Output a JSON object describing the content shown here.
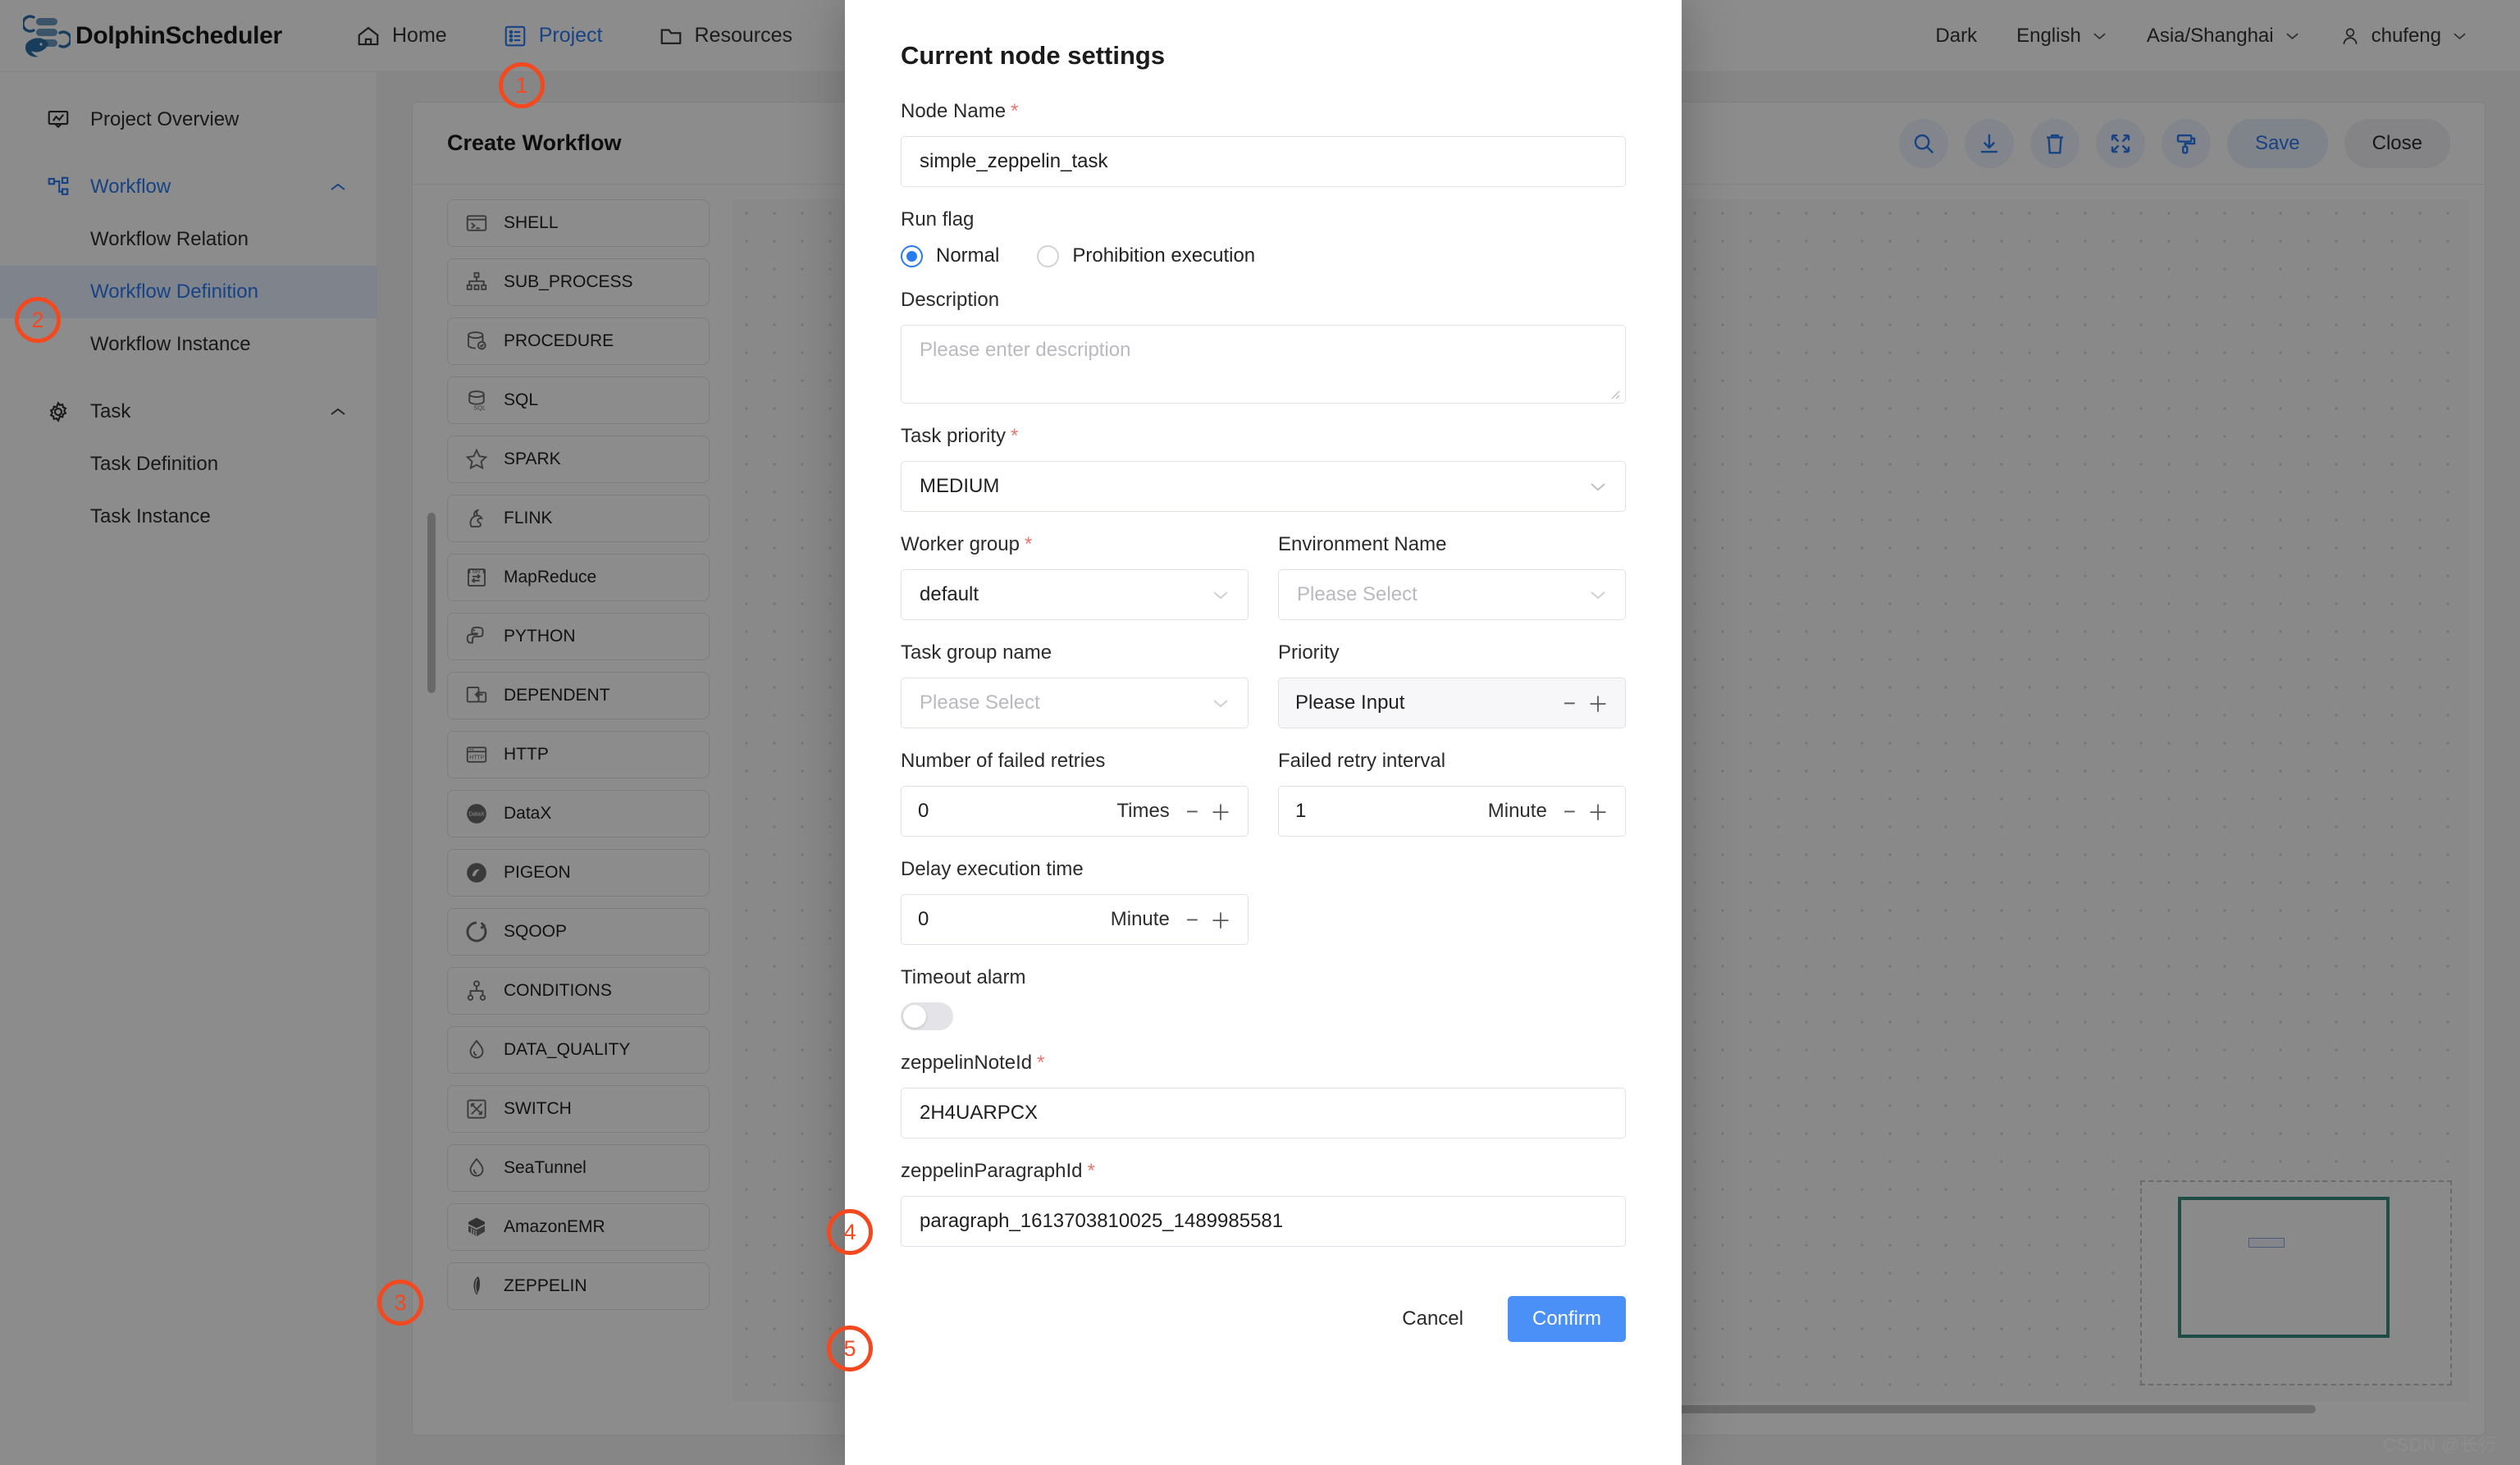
{
  "header": {
    "brand": "DolphinScheduler",
    "nav": [
      {
        "label": "Home",
        "icon": "home-icon",
        "active": false
      },
      {
        "label": "Project",
        "icon": "list-icon",
        "active": true
      },
      {
        "label": "Resources",
        "icon": "folder-icon",
        "active": false
      }
    ],
    "right": {
      "theme": "Dark",
      "language": "English",
      "timezone": "Asia/Shanghai",
      "user": "chufeng"
    }
  },
  "sidebar": {
    "overview": {
      "label": "Project Overview",
      "icon": "dashboard-icon"
    },
    "workflow": {
      "label": "Workflow",
      "icon": "workflow-icon",
      "children": [
        {
          "label": "Workflow Relation",
          "active": false
        },
        {
          "label": "Workflow Definition",
          "active": true
        },
        {
          "label": "Workflow Instance",
          "active": false
        }
      ]
    },
    "task": {
      "label": "Task",
      "icon": "gear-icon",
      "children": [
        {
          "label": "Task Definition",
          "active": false
        },
        {
          "label": "Task Instance",
          "active": false
        }
      ]
    }
  },
  "panel": {
    "title": "Create Workflow",
    "toolbar": {
      "icons": [
        "search-icon",
        "download-icon",
        "trash-icon",
        "fullscreen-icon",
        "format-icon"
      ],
      "save_label": "Save",
      "close_label": "Close"
    },
    "task_types": [
      {
        "label": "SHELL",
        "icon": "terminal-icon"
      },
      {
        "label": "SUB_PROCESS",
        "icon": "hierarchy-icon"
      },
      {
        "label": "PROCEDURE",
        "icon": "database-check-icon"
      },
      {
        "label": "SQL",
        "icon": "database-sql-icon"
      },
      {
        "label": "SPARK",
        "icon": "star-icon"
      },
      {
        "label": "FLINK",
        "icon": "squirrel-icon"
      },
      {
        "label": "MapReduce",
        "icon": "mr-icon"
      },
      {
        "label": "PYTHON",
        "icon": "python-icon"
      },
      {
        "label": "DEPENDENT",
        "icon": "dependent-icon"
      },
      {
        "label": "HTTP",
        "icon": "http-icon"
      },
      {
        "label": "DataX",
        "icon": "datax-icon"
      },
      {
        "label": "PIGEON",
        "icon": "pigeon-icon"
      },
      {
        "label": "SQOOP",
        "icon": "sqoop-icon"
      },
      {
        "label": "CONDITIONS",
        "icon": "conditions-icon"
      },
      {
        "label": "DATA_QUALITY",
        "icon": "droplet-icon"
      },
      {
        "label": "SWITCH",
        "icon": "switch-icon"
      },
      {
        "label": "SeaTunnel",
        "icon": "droplet-icon"
      },
      {
        "label": "AmazonEMR",
        "icon": "emr-icon"
      },
      {
        "label": "ZEPPELIN",
        "icon": "zeppelin-icon"
      }
    ]
  },
  "modal": {
    "title": "Current node settings",
    "node_name": {
      "label": "Node Name",
      "required": true,
      "value": "simple_zeppelin_task"
    },
    "run_flag": {
      "label": "Run flag",
      "options": [
        {
          "label": "Normal",
          "selected": true
        },
        {
          "label": "Prohibition execution",
          "selected": false
        }
      ]
    },
    "description": {
      "label": "Description",
      "value": "",
      "placeholder": "Please enter description"
    },
    "task_priority": {
      "label": "Task priority",
      "required": true,
      "value": "MEDIUM"
    },
    "worker_group": {
      "label": "Worker group",
      "required": true,
      "value": "default"
    },
    "environment_name": {
      "label": "Environment Name",
      "required": false,
      "value": "",
      "placeholder": "Please Select"
    },
    "task_group_name": {
      "label": "Task group name",
      "required": false,
      "value": "",
      "placeholder": "Please Select"
    },
    "priority": {
      "label": "Priority",
      "required": false,
      "value": "",
      "placeholder": "Please Input",
      "disabled": true
    },
    "failed_retries": {
      "label": "Number of failed retries",
      "value": "0",
      "unit": "Times"
    },
    "failed_retry_interval": {
      "label": "Failed retry interval",
      "value": "1",
      "unit": "Minute"
    },
    "delay_execution_time": {
      "label": "Delay execution time",
      "value": "0",
      "unit": "Minute"
    },
    "timeout_alarm": {
      "label": "Timeout alarm",
      "on": false
    },
    "zeppelin_note_id": {
      "label": "zeppelinNoteId",
      "required": true,
      "value": "2H4UARPCX"
    },
    "zeppelin_paragraph_id": {
      "label": "zeppelinParagraphId",
      "required": true,
      "value": "paragraph_1613703810025_1489985581"
    },
    "cancel_label": "Cancel",
    "confirm_label": "Confirm"
  },
  "annotations": [
    {
      "number": "1"
    },
    {
      "number": "2"
    },
    {
      "number": "3"
    },
    {
      "number": "4"
    },
    {
      "number": "5"
    }
  ],
  "watermark": "CSDN @长行",
  "colors": {
    "accent": "#2a7bf0",
    "confirm": "#4a90f7",
    "annotation": "#f4481f",
    "required": "#e8786b",
    "minimap_viewport": "#3b8a84"
  }
}
